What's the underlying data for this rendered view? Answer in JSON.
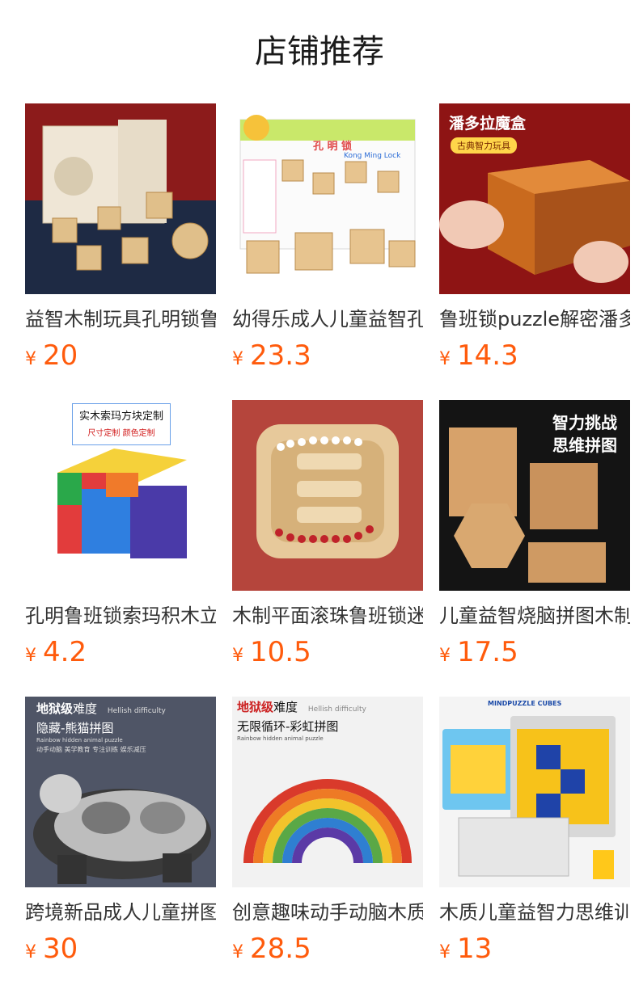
{
  "header": {
    "title": "店铺推荐"
  },
  "currency": "¥",
  "products": [
    {
      "name": "益智木制玩具孔明锁鲁班锁",
      "price": "20",
      "image_icon": "kongming-lock-box-image"
    },
    {
      "name": "幼得乐成人儿童益智孔明锁",
      "price": "23.3",
      "image_icon": "kongming-lock-set-image",
      "image_text": {
        "box_title": "孔 明 锁",
        "box_sub": "Kong Ming Lock"
      }
    },
    {
      "name": "鲁班锁puzzle解密潘多拉魔盒",
      "price": "14.3",
      "image_icon": "pandora-box-image",
      "image_text": {
        "headline": "潘多拉魔盒",
        "pill": "古典智力玩具"
      }
    },
    {
      "name": "孔明鲁班锁索玛积木立方体",
      "price": "4.2",
      "image_icon": "soma-cube-image",
      "image_text": {
        "line1": "实木索玛方块定制",
        "line2": "尺寸定制  颜色定制"
      }
    },
    {
      "name": "木制平面滚珠鲁班锁迷宫",
      "price": "10.5",
      "image_icon": "ball-maze-image"
    },
    {
      "name": "儿童益智烧脑拼图木制玩具",
      "price": "17.5",
      "image_icon": "wood-jigsaw-image",
      "image_text": {
        "line1": "智力挑战",
        "line2": "思维拼图"
      }
    },
    {
      "name": "跨境新品成人儿童拼图玩具",
      "price": "30",
      "image_icon": "panda-puzzle-image",
      "image_text": {
        "level": "地狱级",
        "level_suffix": "难度",
        "level_en": "Hellish difficulty",
        "headline": "隐藏-熊猫拼图",
        "sub_en": "Rainbow hidden animal puzzle",
        "tags": "动手动脑  美学教育  专注训练  娱乐减压"
      }
    },
    {
      "name": "创意趣味动手动脑木质拼图",
      "price": "28.5",
      "image_icon": "rainbow-puzzle-image",
      "image_text": {
        "level": "地狱级",
        "level_suffix": "难度",
        "level_en": "Hellish difficulty",
        "headline": "无限循环-彩虹拼图",
        "sub_en": "Rainbow hidden animal puzzle"
      }
    },
    {
      "name": "木质儿童益智力思维训练",
      "price": "13",
      "image_icon": "mindpuzzle-cubes-image",
      "image_text": {
        "brand": "MINDPUZZLE CUBES"
      }
    }
  ]
}
